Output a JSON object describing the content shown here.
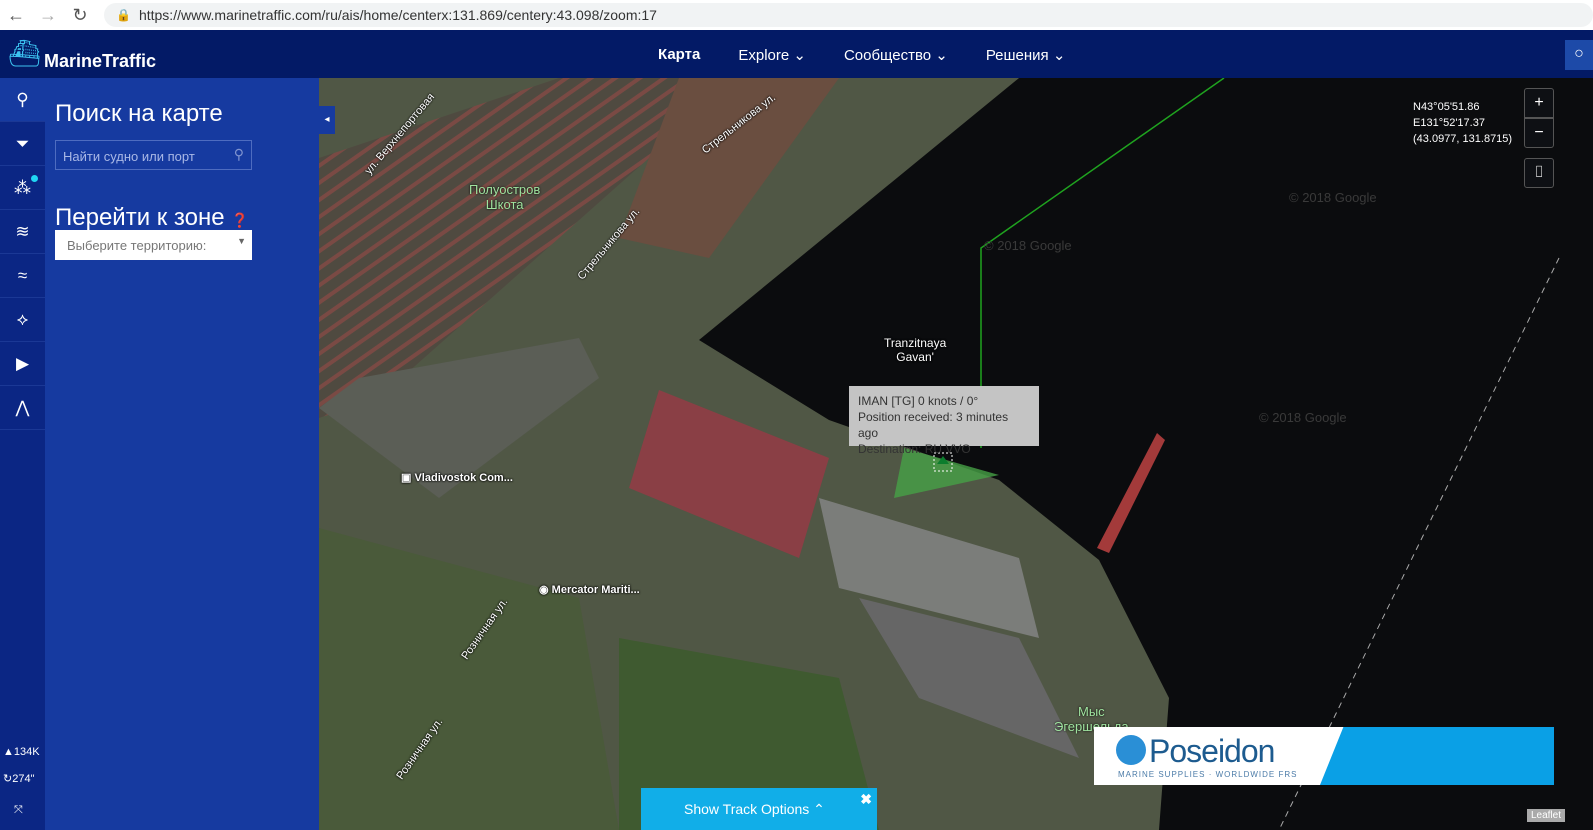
{
  "browser": {
    "url": "https://www.marinetraffic.com/ru/ais/home/centerx:131.869/centery:43.098/zoom:17"
  },
  "header": {
    "brand": "MarineTraffic",
    "nav": [
      {
        "label": "Карта"
      },
      {
        "label": "Explore ⌄"
      },
      {
        "label": "Сообщество ⌄"
      },
      {
        "label": "Решения ⌄"
      }
    ]
  },
  "sidebar": {
    "stats": {
      "ships": "134K",
      "refresh": "274\""
    }
  },
  "panel": {
    "search_title": "Поиск на карте",
    "search_placeholder": "Найти судно или порт",
    "zone_title": "Перейти к зоне",
    "zone_select": "Выберите территорию:"
  },
  "map": {
    "coords": {
      "lat": "N43°05'51.86",
      "lon": "E131°52'17.37",
      "decimal": "(43.0977, 131.8715)"
    },
    "labels": {
      "peninsula1": "Полуостров",
      "peninsula2": "Шкота",
      "street1": "ул. Верхнепортовая",
      "street2": "Стрельникова ул.",
      "street3": "Стрельникова ул.",
      "street4": "Розничная ул.",
      "street5": "Розничная ул.",
      "harbor1": "Tranzitnaya",
      "harbor2": "Gavan'",
      "poi1": "Vladivostok Com...",
      "poi2": "Mercator Mariti...",
      "cape1": "Мыс",
      "cape2": "Эгершельда",
      "watermark": "© 2018 Google"
    },
    "tooltip": {
      "line1": "IMAN [TG] 0 knots / 0°",
      "line2": "Position received: 3 minutes ago",
      "line3": "Destination: RU VVO"
    },
    "ad": {
      "brand": "Poseidon",
      "tagline": "MARINE SUPPLIES · WORLDWIDE FRS"
    },
    "track_button": "Show Track Options",
    "attribution": "Leaflet"
  }
}
